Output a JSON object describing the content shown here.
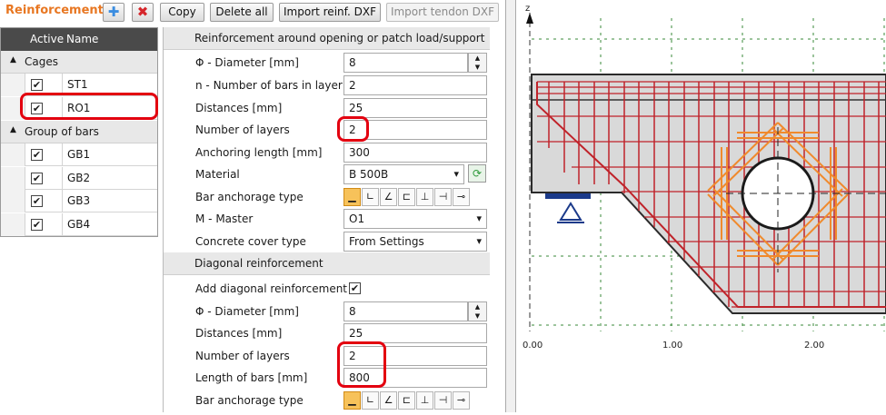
{
  "toolbar": {
    "title": "Reinforcement",
    "add_icon": "plus-icon",
    "delete_icon": "x-icon",
    "copy_label": "Copy",
    "delete_all_label": "Delete all",
    "import_reinf_label": "Import reinf. DXF",
    "import_tendon_label": "Import tendon DXF"
  },
  "tree": {
    "col_active": "Active",
    "col_name": "Name",
    "groups": [
      {
        "label": "Cages",
        "items": [
          {
            "name": "ST1",
            "active": true
          },
          {
            "name": "RO1",
            "active": true
          }
        ]
      },
      {
        "label": "Group of bars",
        "items": [
          {
            "name": "GB1",
            "active": true
          },
          {
            "name": "GB2",
            "active": true
          },
          {
            "name": "GB3",
            "active": true
          },
          {
            "name": "GB4",
            "active": true
          }
        ]
      }
    ]
  },
  "props": {
    "section1": "Reinforcement around opening or patch load/support",
    "diameter_label": "Φ - Diameter [mm]",
    "diameter_value": "8",
    "bars_in_layer_label": "n - Number of bars in layer",
    "bars_in_layer_value": "2",
    "distances_label": "Distances [mm]",
    "distances_value": "25",
    "layers_label": "Number of layers",
    "layers_value": "2",
    "anchoring_label": "Anchoring length [mm]",
    "anchoring_value": "300",
    "material_label": "Material",
    "material_value": "B 500B",
    "anchorage_label": "Bar anchorage type",
    "master_label": "M - Master",
    "master_value": "O1",
    "cover_label": "Concrete cover type",
    "cover_value": "From Settings",
    "section2": "Diagonal reinforcement",
    "add_diag_label": "Add diagonal reinforcement",
    "add_diag_checked": true,
    "d_diameter_label": "Φ - Diameter [mm]",
    "d_diameter_value": "8",
    "d_distances_label": "Distances [mm]",
    "d_distances_value": "25",
    "d_layers_label": "Number of layers",
    "d_layers_value": "2",
    "d_length_label": "Length of bars [mm]",
    "d_length_value": "800",
    "d_anchorage_label": "Bar anchorage type"
  },
  "canvas": {
    "z_axis_label": "z",
    "x_ticks": [
      "0.00",
      "1.00",
      "2.00"
    ]
  },
  "colors": {
    "title": "#e87722",
    "highlight": "#e3000f",
    "rebar": "#c0232a",
    "diag_rebar": "#f08a2c",
    "concrete": "#d9d9d9"
  }
}
